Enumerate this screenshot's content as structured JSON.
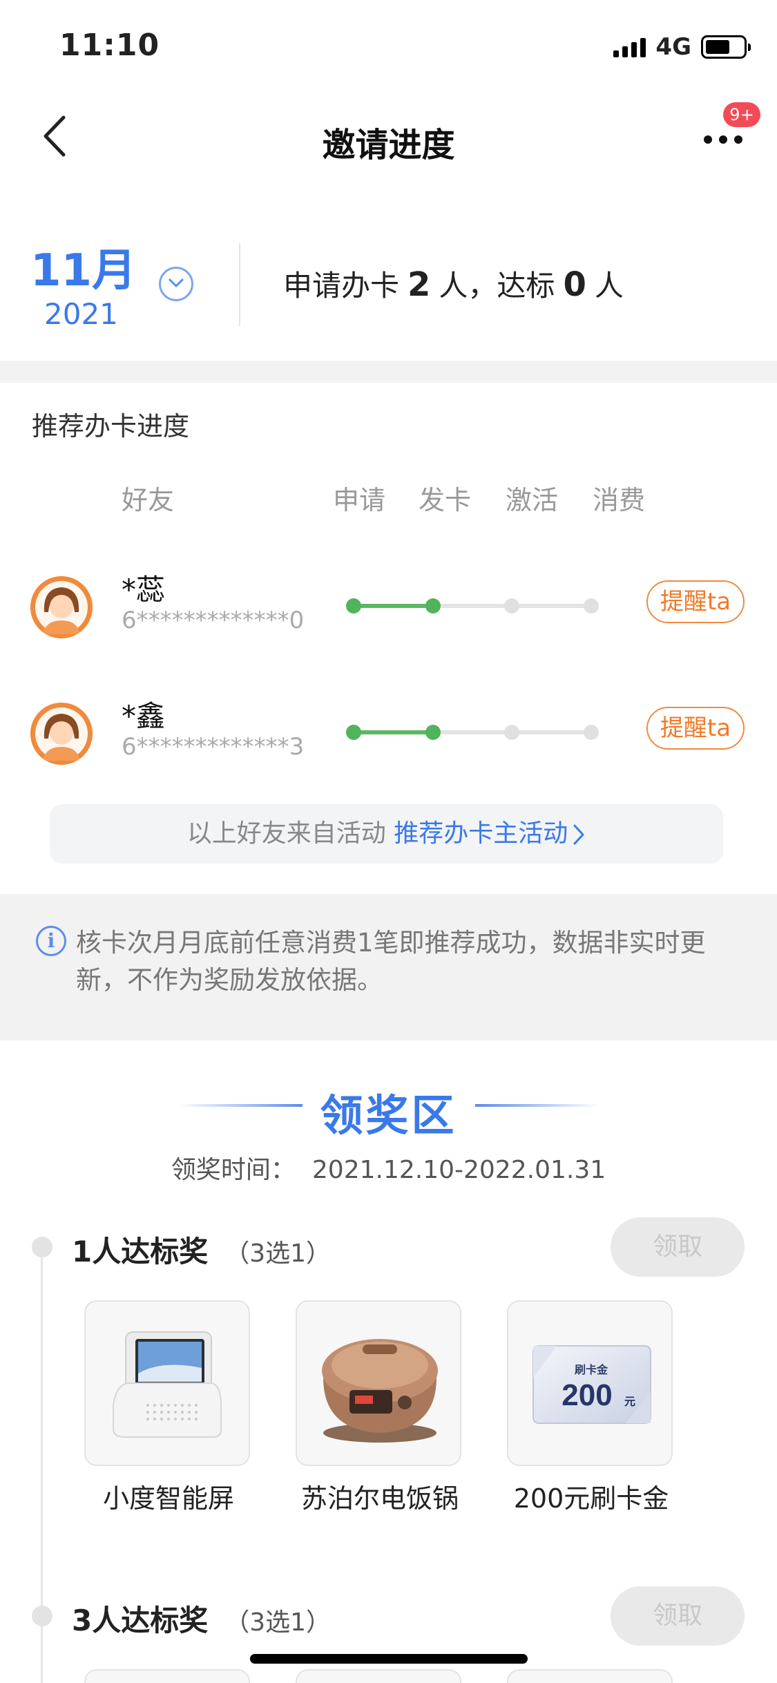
{
  "status_bar": {
    "time": "11:10",
    "network": "4G"
  },
  "nav": {
    "title": "邀请进度",
    "badge": "9+"
  },
  "summary": {
    "month": "11月",
    "year": "2021",
    "prefix": "申请办卡",
    "applied": "2",
    "mid": "人，达标",
    "qualified": "0",
    "suffix": "人"
  },
  "progress": {
    "title": "推荐办卡进度",
    "columns": {
      "friend": "好友",
      "stages": [
        "申请",
        "发卡",
        "激活",
        "消费"
      ]
    },
    "friends": [
      {
        "name": "*蕊",
        "card": "6*************0",
        "completed_stages": 2,
        "action": "提醒ta"
      },
      {
        "name": "*鑫",
        "card": "6*************3",
        "completed_stages": 2,
        "action": "提醒ta"
      }
    ],
    "source_text": "以上好友来自活动",
    "source_link": "推荐办卡主活动"
  },
  "notice": {
    "text": "核卡次月月底前任意消费1笔即推荐成功，数据非实时更新，不作为奖励发放依据。"
  },
  "award": {
    "title": "领奖区",
    "time_label": "领奖时间：",
    "time_value": "2021.12.10-2022.01.31",
    "tiers": [
      {
        "name": "1人达标奖",
        "pick": "（3选1）",
        "button": "领取",
        "prizes": [
          {
            "label": "小度智能屏"
          },
          {
            "label": "苏泊尔电饭锅"
          },
          {
            "label": "200元刷卡金",
            "card_title": "刷卡金",
            "card_amount": "200",
            "card_unit": "元"
          }
        ]
      },
      {
        "name": "3人达标奖",
        "pick": "（3选1）",
        "button": "领取"
      }
    ]
  },
  "colors": {
    "accent": "#3a79e9",
    "progress": "#5cb862",
    "remind": "#f07a27",
    "badge": "#f24b57"
  }
}
